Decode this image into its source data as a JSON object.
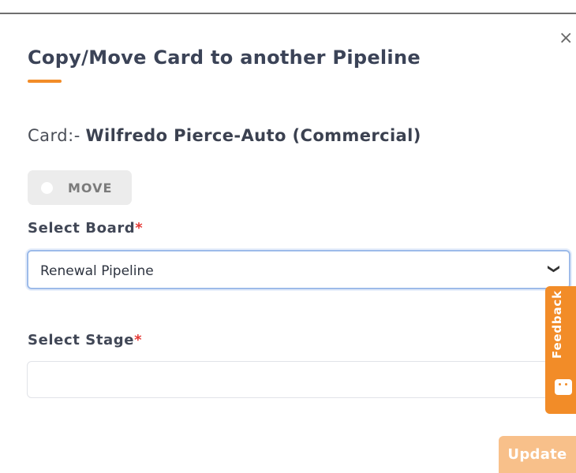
{
  "modal": {
    "close_label": "×",
    "title": "Copy/Move Card to another Pipeline",
    "card_prefix": "Card:-",
    "card_name": "Wilfredo Pierce-Auto (Commercial)",
    "move_toggle": {
      "label": "MOVE",
      "state": "off"
    },
    "board": {
      "label": "Select Board",
      "required_mark": "*",
      "selected": "Renewal Pipeline"
    },
    "stage": {
      "label": "Select Stage",
      "required_mark": "*",
      "value": ""
    },
    "update_label": "Update"
  },
  "feedback_tab": {
    "label": "Feedback",
    "icon": "smiley-face-icon"
  },
  "colors": {
    "accent": "#f28c28",
    "required": "#e53935",
    "update_disabled": "#f8c08a",
    "focus_border": "#9dbbe9"
  }
}
